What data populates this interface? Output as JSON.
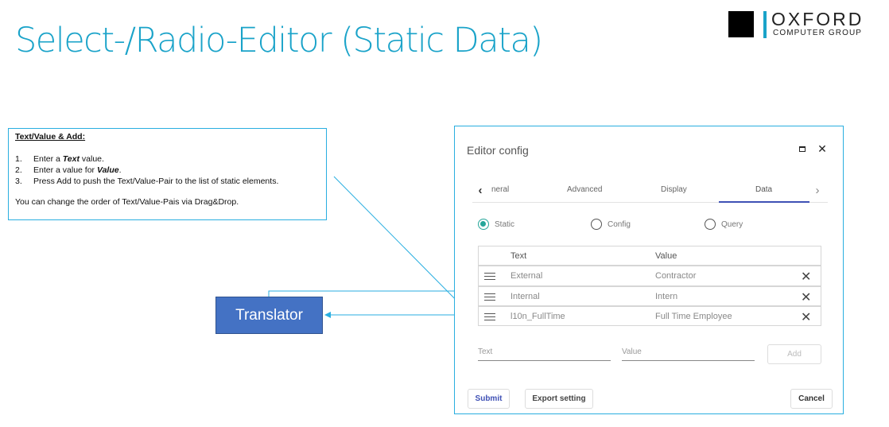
{
  "slide": {
    "title": "Select-/Radio-Editor (Static Data)"
  },
  "logo": {
    "main": "OXFORD",
    "sub": "COMPUTER GROUP"
  },
  "note": {
    "title": "Text/Value & Add:",
    "steps": [
      {
        "num": "1.",
        "pre": "Enter a ",
        "em": "Text",
        "post": " value."
      },
      {
        "num": "2.",
        "pre": "Enter a value for ",
        "em": "Value",
        "post": "."
      },
      {
        "num": "3.",
        "pre": "Press Add to push the Text/Value-Pair to the list of static elements.",
        "em": "",
        "post": ""
      }
    ],
    "footer": "You can change the order of Text/Value-Pais via Drag&Drop."
  },
  "translator": {
    "label": "Translator"
  },
  "dialog": {
    "title": "Editor config",
    "maximize_icon": "maximize-icon",
    "close_glyph": "✕",
    "tabs": {
      "prev_glyph": "‹",
      "next_glyph": "›",
      "general": "neral",
      "advanced": "Advanced",
      "display": "Display",
      "data": "Data",
      "active": "Data"
    },
    "radios": {
      "static": "Static",
      "config": "Config",
      "query": "Query",
      "selected": "Static"
    },
    "grid": {
      "headers": {
        "text": "Text",
        "value": "Value"
      },
      "rows": [
        {
          "text": "External",
          "value": "Contractor"
        },
        {
          "text": "Internal",
          "value": "Intern"
        },
        {
          "text": "l10n_FullTime",
          "value": "Full Time Employee"
        }
      ],
      "delete_glyph": "✕"
    },
    "inputs": {
      "text_placeholder": "Text",
      "value_placeholder": "Value",
      "add_label": "Add"
    },
    "footer": {
      "submit": "Submit",
      "export": "Export setting",
      "cancel": "Cancel"
    }
  },
  "colors": {
    "title": "#1aa3c9",
    "accent_border": "#29aee0",
    "translator_fill": "#4472c4",
    "radio_checked": "#26a69a",
    "tab_indicator": "#3f51b5",
    "submit_text": "#3f51b5"
  }
}
